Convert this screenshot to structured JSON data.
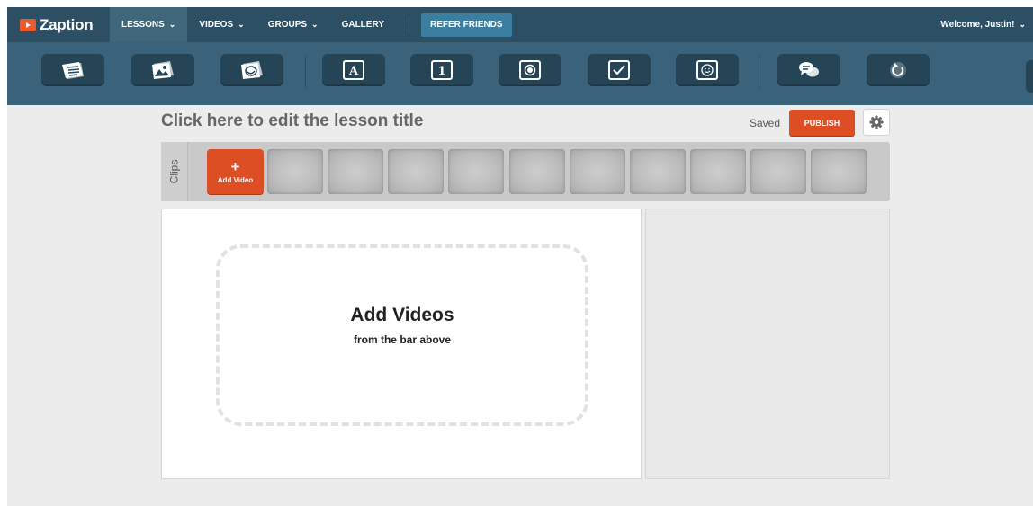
{
  "brand": {
    "name": "Zaption",
    "logo_icon": "play-icon",
    "accent": "#e8592d"
  },
  "nav": {
    "items": [
      {
        "label": "LESSONS",
        "dropdown": true,
        "active": true
      },
      {
        "label": "VIDEOS",
        "dropdown": true,
        "active": false
      },
      {
        "label": "GROUPS",
        "dropdown": true,
        "active": false
      },
      {
        "label": "GALLERY",
        "dropdown": false,
        "active": false
      }
    ],
    "refer_label": "REFER FRIENDS",
    "welcome_label": "Welcome, Justin!",
    "bar_color": "#2c4f63"
  },
  "toolbar": {
    "tools": [
      {
        "name": "text-slide-icon"
      },
      {
        "name": "image-slide-icon"
      },
      {
        "name": "drawing-slide-icon"
      },
      {
        "name": "open-response-icon",
        "glyph": "A"
      },
      {
        "name": "numerical-icon",
        "glyph": "1"
      },
      {
        "name": "multiple-choice-icon"
      },
      {
        "name": "check-boxes-icon"
      },
      {
        "name": "draw-response-icon"
      },
      {
        "name": "discussion-icon"
      },
      {
        "name": "jump-icon"
      }
    ]
  },
  "editor": {
    "lesson_title": "Click here to edit the lesson title",
    "status": "Saved",
    "publish_label": "PUBLISH",
    "publish_color": "#dd4e25",
    "settings_icon": "gear-icon"
  },
  "clips": {
    "label": "Clips",
    "add_video": {
      "plus": "+",
      "label": "Add Video"
    },
    "empty_slot_count": 10
  },
  "dropzone": {
    "title": "Add Videos",
    "subtitle": "from the bar above"
  }
}
